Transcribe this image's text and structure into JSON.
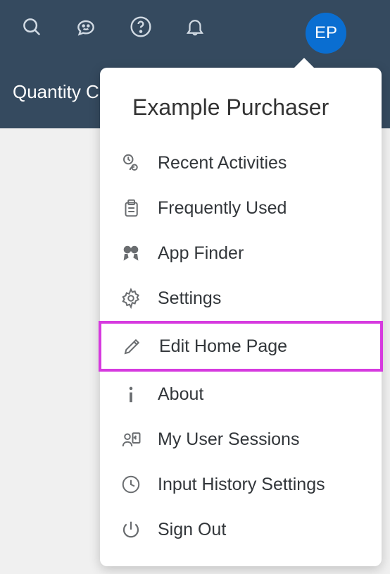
{
  "header": {
    "avatar_initials": "EP",
    "breadcrumb": "Quantity C"
  },
  "popover": {
    "title": "Example Purchaser",
    "items": [
      {
        "icon": "recent-activities-icon",
        "label": "Recent Activities"
      },
      {
        "icon": "frequently-used-icon",
        "label": "Frequently Used"
      },
      {
        "icon": "app-finder-icon",
        "label": "App Finder"
      },
      {
        "icon": "settings-icon",
        "label": "Settings"
      },
      {
        "icon": "edit-icon",
        "label": "Edit Home Page"
      },
      {
        "icon": "about-icon",
        "label": "About"
      },
      {
        "icon": "user-sessions-icon",
        "label": "My User Sessions"
      },
      {
        "icon": "history-icon",
        "label": "Input History Settings"
      },
      {
        "icon": "sign-out-icon",
        "label": "Sign Out"
      }
    ],
    "highlighted_index": 4
  },
  "colors": {
    "header_bg": "#354a5f",
    "avatar_bg": "#0a6ed1",
    "highlight": "#d63adf"
  }
}
